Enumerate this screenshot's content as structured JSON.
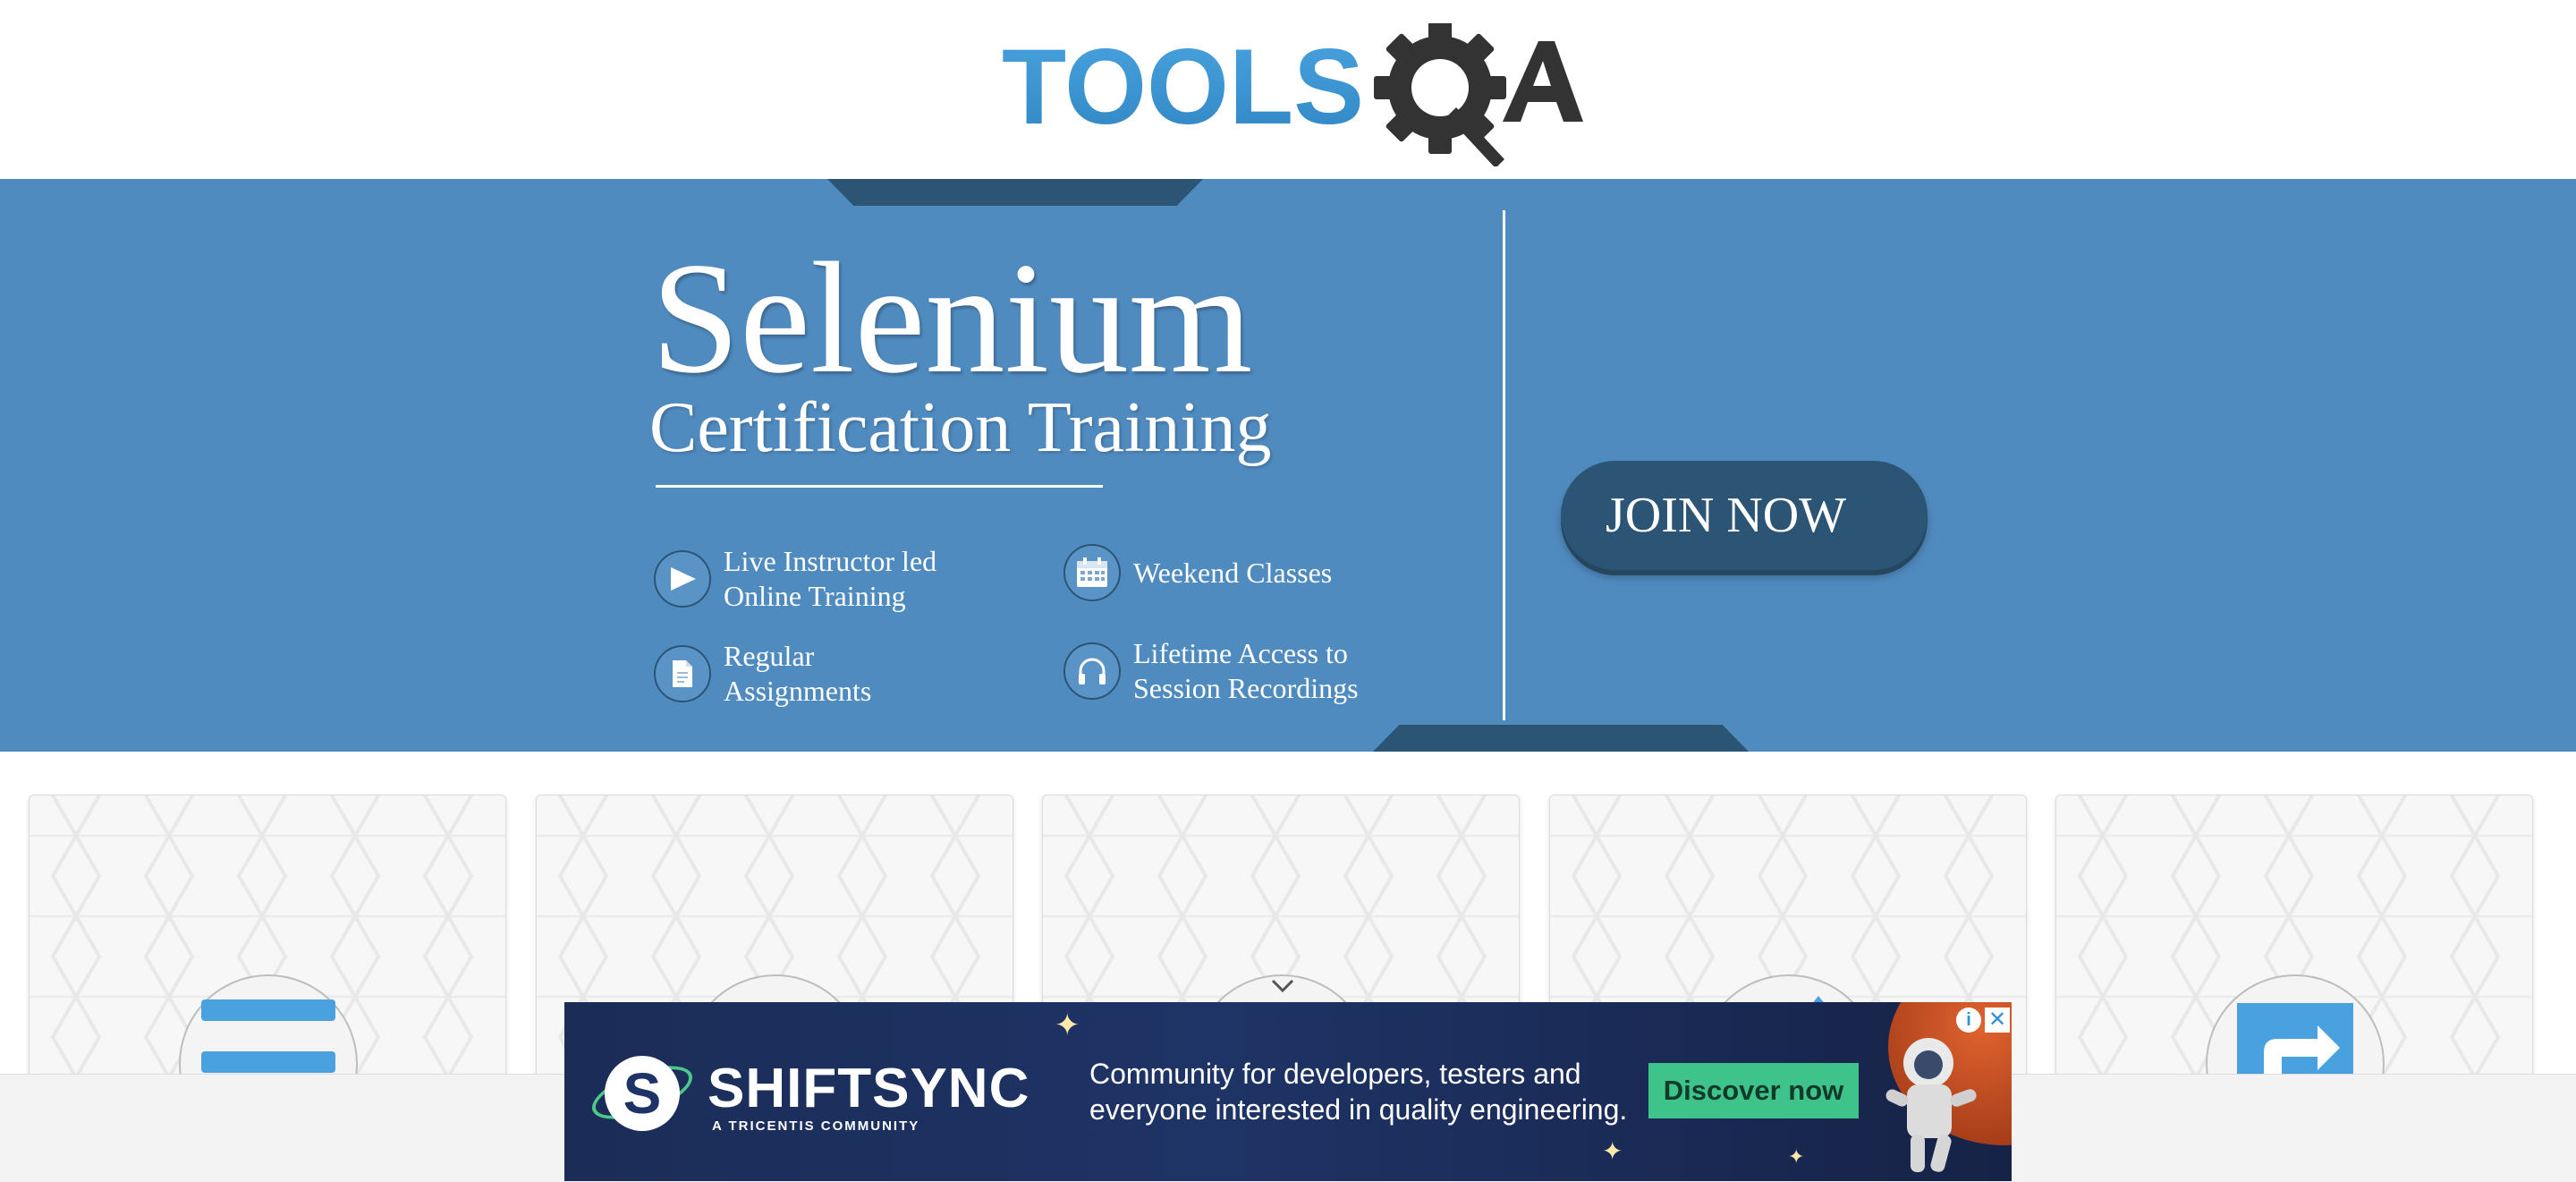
{
  "header": {
    "logo_text_left": "TOOLS",
    "logo_text_right": "QA"
  },
  "banner": {
    "title": "Selenium",
    "subtitle": "Certification Training",
    "features": [
      {
        "icon": "play-icon",
        "line1": "Live Instructor led",
        "line2": "Online Training"
      },
      {
        "icon": "calendar-icon",
        "line1": "Weekend Classes",
        "line2": ""
      },
      {
        "icon": "document-icon",
        "line1": "Regular",
        "line2": "Assignments"
      },
      {
        "icon": "headphones-icon",
        "line1": "Lifetime Access to",
        "line2": "Session Recordings"
      }
    ],
    "cta_label": "JOIN NOW"
  },
  "cards": [
    {
      "icon": "hamburger-icon"
    },
    {
      "icon": "card-icon"
    },
    {
      "icon": "chevron-icon"
    },
    {
      "icon": "card-icon"
    },
    {
      "icon": "share-arrow-icon"
    }
  ],
  "ad": {
    "logo_letter": "S",
    "brand": "SHIFTSYNC",
    "tagline": "A TRICENTIS COMMUNITY",
    "copy_line1": "Community for developers, testers and",
    "copy_line2": "everyone interested in quality engineering.",
    "cta_label": "Discover now",
    "info_label": "i",
    "close_label": "✕"
  },
  "colors": {
    "banner_bg": "#508bc0",
    "banner_dark": "#2c5474",
    "logo_blue": "#3d96d1",
    "logo_gray": "#333333",
    "ad_cta": "#3ec48a"
  }
}
